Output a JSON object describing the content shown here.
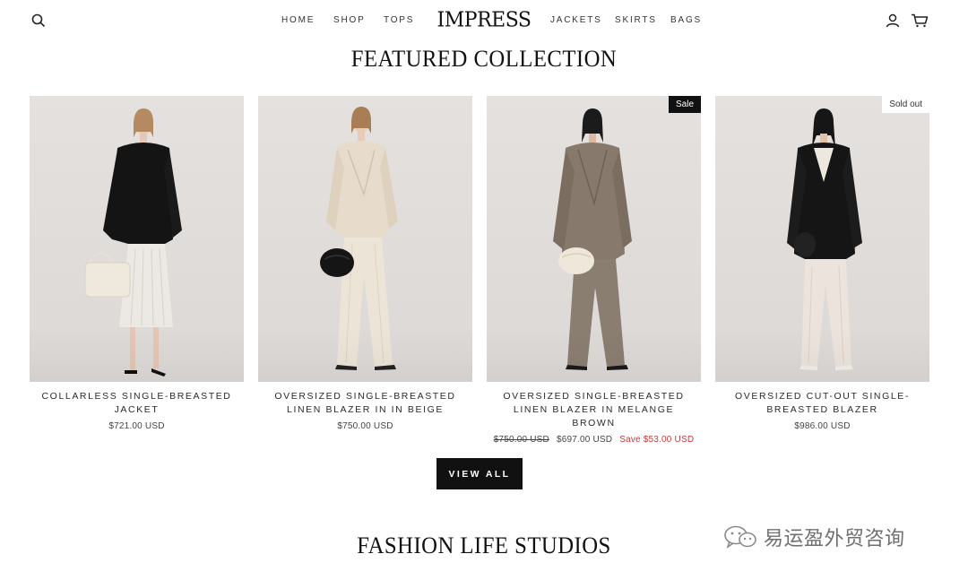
{
  "header": {
    "logo": "IMPRESS",
    "nav_left": [
      "HOME",
      "SHOP",
      "TOPS"
    ],
    "nav_right": [
      "JACKETS",
      "SKIRTS",
      "BAGS"
    ],
    "icons": [
      "search-icon",
      "account-icon",
      "cart-icon"
    ]
  },
  "featured": {
    "title": "FEATURED COLLECTION",
    "products": [
      {
        "name": "COLLARLESS SINGLE-BREASTED JACKET",
        "price": "$721.00 USD",
        "badge": ""
      },
      {
        "name": "OVERSIZED SINGLE-BREASTED LINEN BLAZER IN IN BEIGE",
        "price": "$750.00 USD",
        "badge": ""
      },
      {
        "name": "OVERSIZED SINGLE-BREASTED LINEN BLAZER IN MELANGE BROWN",
        "compare_price": "$750.00 USD",
        "price": "$697.00 USD",
        "save": "Save $53.00 USD",
        "badge": "Sale"
      },
      {
        "name": "OVERSIZED CUT-OUT SINGLE-BREASTED BLAZER",
        "price": "$986.00 USD",
        "badge": "Sold out"
      }
    ],
    "view_all_label": "VIEW ALL"
  },
  "studios": {
    "title": "FASHION LIFE STUDIOS"
  },
  "watermark": {
    "text": "易运盈外贸咨询"
  },
  "colors": {
    "badge_sale_bg": "#111111",
    "save_text": "#c23a3a",
    "button_bg": "#111111"
  }
}
